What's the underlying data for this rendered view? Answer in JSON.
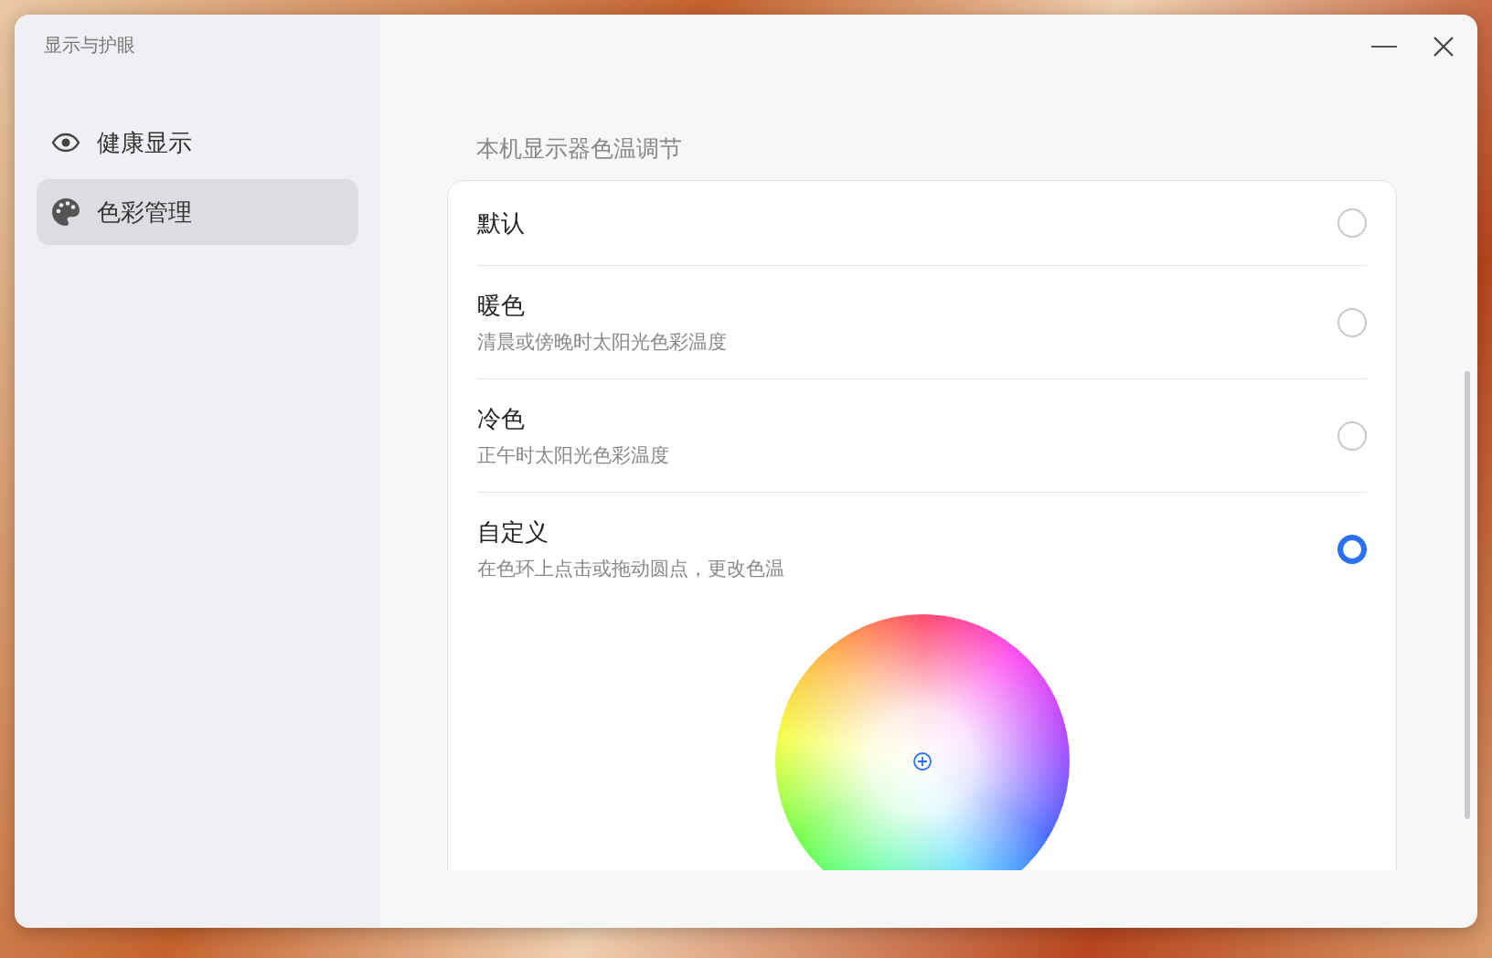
{
  "window": {
    "title": "显示与护眼"
  },
  "sidebar": {
    "items": [
      {
        "label": "健康显示",
        "selected": false
      },
      {
        "label": "色彩管理",
        "selected": true
      }
    ]
  },
  "section": {
    "heading": "本机显示器色温调节",
    "options": [
      {
        "title": "默认",
        "selected": false
      },
      {
        "title": "暖色",
        "subtitle": "清晨或傍晚时太阳光色彩温度",
        "selected": false
      },
      {
        "title": "冷色",
        "subtitle": "正午时太阳光色彩温度",
        "selected": false
      },
      {
        "title": "自定义",
        "subtitle": "在色环上点击或拖动圆点，更改色温",
        "selected": true
      }
    ]
  }
}
